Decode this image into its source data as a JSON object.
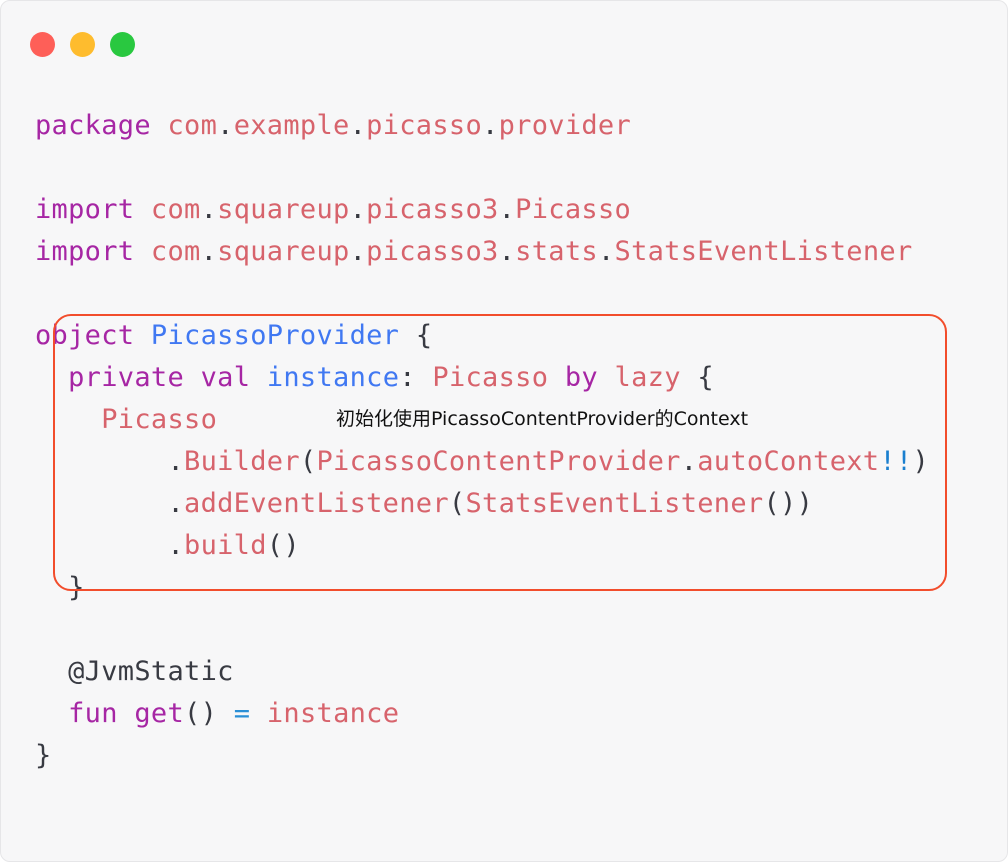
{
  "colors": {
    "keyword": "#a626a4",
    "type": "#4078f2",
    "identifier": "#d7636c",
    "punctuation": "#383a42",
    "operator": "#2a8fd6",
    "highlight_box": "#f24d2c",
    "background": "#f7f7f8"
  },
  "window": {
    "traffic_lights": [
      "close-dot",
      "minimize-dot",
      "zoom-dot"
    ]
  },
  "code": {
    "line1": {
      "kw": "package",
      "p1": "com",
      "d1": ".",
      "p2": "example",
      "d2": ".",
      "p3": "picasso",
      "d3": ".",
      "p4": "provider"
    },
    "line3": {
      "kw": "import",
      "p1": "com",
      "d1": ".",
      "p2": "squareup",
      "d2": ".",
      "p3": "picasso3",
      "d3": ".",
      "p4": "Picasso"
    },
    "line4": {
      "kw": "import",
      "p1": "com",
      "d1": ".",
      "p2": "squareup",
      "d2": ".",
      "p3": "picasso3",
      "d3": ".",
      "p4": "stats",
      "d4": ".",
      "p5": "StatsEventListener"
    },
    "line6": {
      "kw": "object",
      "name": "PicassoProvider",
      "brace": "{"
    },
    "line7": {
      "kw1": "private",
      "kw2": "val",
      "name": "instance",
      "colon": ":",
      "type": "Picasso",
      "kw3": "by",
      "fn": "lazy",
      "brace": "{"
    },
    "line8": {
      "name": "Picasso"
    },
    "line9": {
      "dot": ".",
      "fn": "Builder",
      "open": "(",
      "cls": "PicassoContentProvider",
      "dot2": ".",
      "prop": "autoContext",
      "bang": "!!",
      "close": ")"
    },
    "line10": {
      "dot": ".",
      "fn": "addEventListener",
      "open": "(",
      "cls": "StatsEventListener",
      "close": "())"
    },
    "line11": {
      "dot": ".",
      "fn": "build",
      "parens": "()"
    },
    "line12": {
      "brace": "}"
    },
    "line14": {
      "annotation": "@JvmStatic"
    },
    "line15": {
      "kw": "fun",
      "fn": "get",
      "parens": "()",
      "eq": "=",
      "val": "instance"
    },
    "line16": {
      "brace": "}"
    }
  },
  "annotation_text": "初始化使用PicassoContentProvider的Context"
}
